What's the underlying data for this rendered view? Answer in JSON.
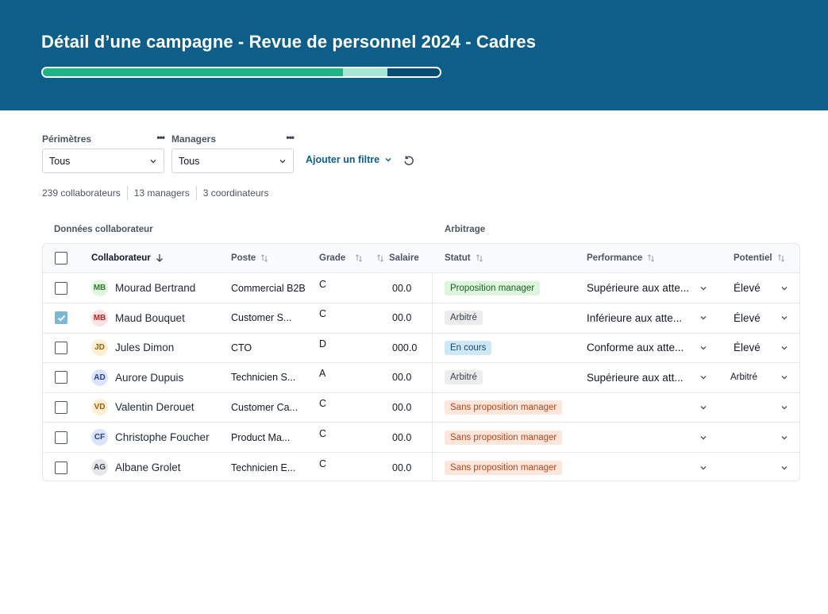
{
  "header": {
    "title": "Détail d’une campagne - Revue de personnel 2024 - Cadres",
    "progress": [
      {
        "fraction": 0.755,
        "color": "#1fb488"
      },
      {
        "fraction": 0.113,
        "color": "#a8e6d4"
      },
      {
        "fraction": 0.132,
        "color": "#0a4d74"
      }
    ]
  },
  "filters": {
    "perimetres": {
      "label": "Périmètres",
      "value": "Tous"
    },
    "managers": {
      "label": "Managers",
      "value": "Tous"
    },
    "add_filter": "Ajouter un filtre"
  },
  "counts": [
    "239 collaborateurs",
    "13 managers",
    "3 coordinateurs"
  ],
  "groups": {
    "left": "Données collaborateur",
    "right": "Arbitrage"
  },
  "columns": {
    "collaborateur": "Collaborateur",
    "poste": "Poste",
    "grade": "Grade",
    "salaire": "Salaire",
    "statut": "Statut",
    "performance": "Performance",
    "potentiel": "Potentiel"
  },
  "rows": [
    {
      "checked": false,
      "initials": "MB",
      "avatar_bg": "#e3f5e1",
      "avatar_fg": "#2f7d32",
      "name": "Mourad Bertrand",
      "poste": "Commercial B2B",
      "grade": "C",
      "salaire": "00.0",
      "statut": "Proposition manager",
      "statut_bg": "#dcf5dc",
      "statut_fg": "#1f5f26",
      "performance": "Supérieure aux atte...",
      "potentiel": "Élevé",
      "potentiel_small": false
    },
    {
      "checked": true,
      "initials": "MB",
      "avatar_bg": "#fde2e2",
      "avatar_fg": "#b42323",
      "name": "Maud Bouquet",
      "poste": "Customer S...",
      "grade": "C",
      "salaire": "00.0",
      "statut": "Arbitré",
      "statut_bg": "#ececec",
      "statut_fg": "#374151",
      "performance": "Inférieure aux atte...",
      "potentiel": "Élevé",
      "potentiel_small": false
    },
    {
      "checked": false,
      "initials": "JD",
      "avatar_bg": "#fdefd3",
      "avatar_fg": "#a15c07",
      "name": "Jules Dimon",
      "poste": "CTO",
      "grade": "D",
      "salaire": "000.0",
      "statut": "En cours",
      "statut_bg": "#cfe8f7",
      "statut_fg": "#0b4a6f",
      "performance": "Conforme aux atte...",
      "potentiel": "Élevé",
      "potentiel_small": false
    },
    {
      "checked": false,
      "initials": "AD",
      "avatar_bg": "#dbe4ff",
      "avatar_fg": "#2a3f8f",
      "name": "Aurore Dupuis",
      "poste": "Technicien S...",
      "grade": "A",
      "salaire": "00.0",
      "statut": "Arbitré",
      "statut_bg": "#ececec",
      "statut_fg": "#374151",
      "performance": "Supérieure aux att...",
      "potentiel": "Arbitré",
      "potentiel_small": true
    },
    {
      "checked": false,
      "initials": "VD",
      "avatar_bg": "#fdefd3",
      "avatar_fg": "#a15c07",
      "name": "Valentin Derouet",
      "poste": "Customer Ca...",
      "grade": "C",
      "salaire": "00.0",
      "statut": "Sans proposition manager",
      "statut_bg": "#fde6dc",
      "statut_fg": "#b4461c",
      "performance": "",
      "potentiel": "",
      "potentiel_small": false
    },
    {
      "checked": false,
      "initials": "CF",
      "avatar_bg": "#dbe4ff",
      "avatar_fg": "#2a3f8f",
      "name": "Christophe Foucher",
      "poste": "Product Ma...",
      "grade": "C",
      "salaire": "00.0",
      "statut": "Sans proposition manager",
      "statut_bg": "#fde6dc",
      "statut_fg": "#b4461c",
      "performance": "",
      "potentiel": "",
      "potentiel_small": false
    },
    {
      "checked": false,
      "initials": "AG",
      "avatar_bg": "#e5e7eb",
      "avatar_fg": "#374151",
      "name": "Albane Grolet",
      "poste": "Technicien  E...",
      "grade": "C",
      "salaire": "00.0",
      "statut": "Sans proposition manager",
      "statut_bg": "#fde6dc",
      "statut_fg": "#b4461c",
      "performance": "",
      "potentiel": "",
      "potentiel_small": false
    }
  ]
}
